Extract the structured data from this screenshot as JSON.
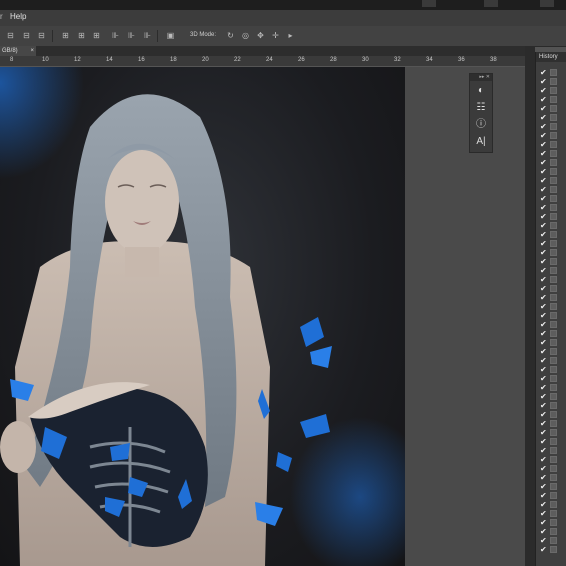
{
  "menu": {
    "help": "Help"
  },
  "options_bar": {
    "mode_label": "3D Mode:"
  },
  "document_tab": {
    "title": "GB/8)",
    "close": "×"
  },
  "ruler": {
    "ticks": [
      "8",
      "10",
      "12",
      "14",
      "16",
      "18",
      "20",
      "22",
      "24",
      "26",
      "28",
      "30",
      "32",
      "34",
      "36",
      "38"
    ]
  },
  "float_panel": {
    "header": "▸▸ ✕"
  },
  "history": {
    "title": "History"
  },
  "colors": {
    "photo_blue": "#1f6fd6",
    "skin": "#c9b9ad",
    "hair": "#8f9aa6",
    "ui_dark": "#3c3c3c"
  }
}
